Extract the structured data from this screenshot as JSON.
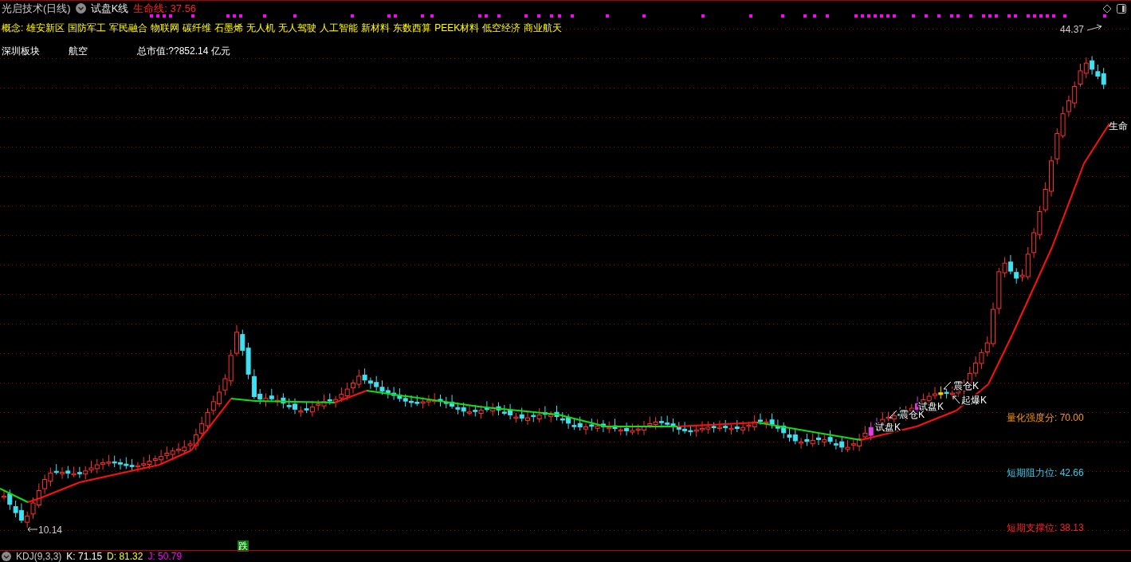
{
  "header": {
    "stock": "光启技术(日线)",
    "indicator": "试盘K线",
    "life_line": "生命线: 37.56"
  },
  "concepts": {
    "label": "概念:",
    "items": [
      "雄安新区",
      "国防军工",
      "军民融合",
      "物联网",
      "碳纤维",
      "石墨烯",
      "无人机",
      "无人驾驶",
      "人工智能",
      "新材料",
      "东数西算",
      "PEEK材料",
      "低空经济",
      "商业航天"
    ]
  },
  "info": {
    "board": "深圳板块",
    "industry": "航空",
    "market_cap": "总市值:??852.14 亿元"
  },
  "chart": {
    "high_label": "44.37",
    "low_label": "10.14",
    "line_label": "生命",
    "signals": [
      {
        "kind": "trial",
        "text": "试盘K"
      },
      {
        "kind": "shake",
        "text": "震仓K"
      },
      {
        "kind": "trial",
        "text": "试盘K"
      },
      {
        "kind": "shake",
        "text": "震仓K"
      },
      {
        "kind": "launch",
        "text": "起爆K"
      }
    ],
    "badge": "跌"
  },
  "metrics": [
    {
      "label": "量化强度分:",
      "value": "70.00",
      "color": "#ff9900"
    },
    {
      "label": "短期阻力位:",
      "value": "42.66",
      "color": "#33ccee"
    },
    {
      "label": "短期支撑位:",
      "value": "38.13",
      "color": "#ff2020"
    }
  ],
  "indicator_bar": {
    "name": "KDJ(9,3,3)",
    "values": [
      {
        "label": "K:",
        "value": "71.15",
        "color": "#ffffff"
      },
      {
        "label": "D:",
        "value": "81.32",
        "color": "#ffff00"
      },
      {
        "label": "J:",
        "value": "50.79",
        "color": "#ff00ff"
      }
    ]
  }
}
